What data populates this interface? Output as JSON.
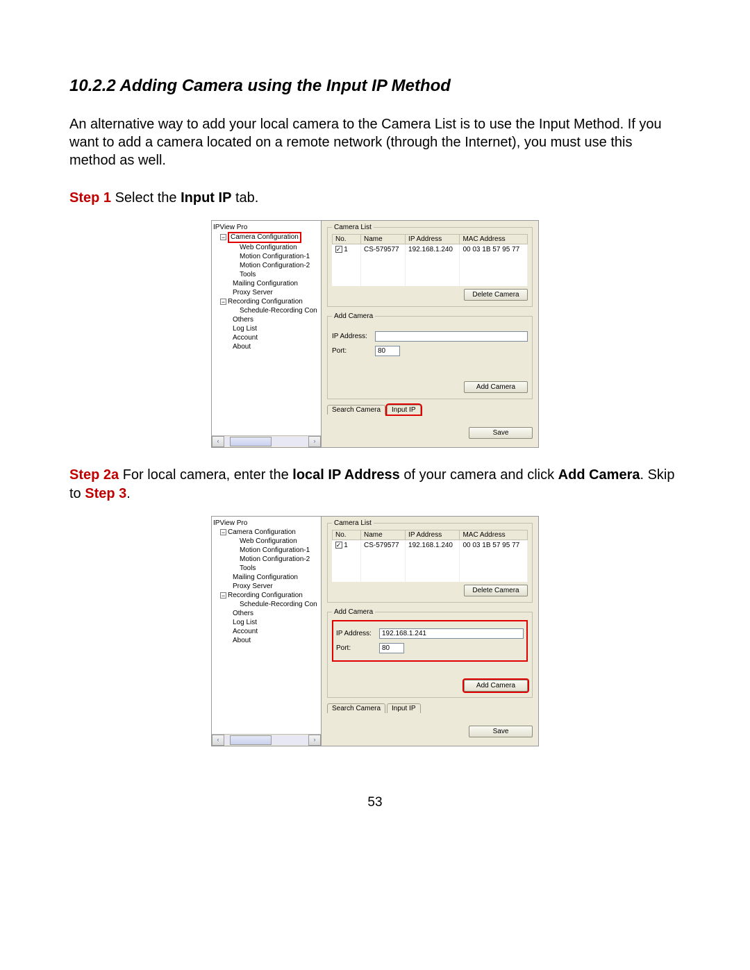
{
  "heading": "10.2.2 Adding Camera using the Input IP Method",
  "intro": "An alternative way to add your local camera to the Camera List is to use the Input Method. If you want to add a camera located on a remote network (through the Internet), you must use this method as well.",
  "step1": {
    "label": "Step 1",
    "text_a": " Select the ",
    "bold": "Input IP",
    "text_b": " tab."
  },
  "step2a": {
    "label": "Step 2a",
    "text_a": " For local camera, enter the ",
    "bold1": "local IP Address",
    "text_b": " of your camera and click ",
    "bold2": "Add Camera",
    "text_c": ". Skip to ",
    "red2": "Step 3",
    "text_d": "."
  },
  "tree": {
    "root": "IPView Pro",
    "items": [
      {
        "label": "Camera Configuration",
        "children": [
          {
            "label": "Web Configuration"
          },
          {
            "label": "Motion Configuration-1"
          },
          {
            "label": "Motion Configuration-2"
          },
          {
            "label": "Tools"
          }
        ]
      },
      {
        "label": "Mailing Configuration"
      },
      {
        "label": "Proxy Server"
      },
      {
        "label": "Recording Configuration",
        "children": [
          {
            "label": "Schedule-Recording Con"
          }
        ]
      },
      {
        "label": "Others"
      },
      {
        "label": "Log List"
      },
      {
        "label": "Account"
      },
      {
        "label": "About"
      }
    ]
  },
  "camera_list": {
    "legend": "Camera List",
    "headers": [
      "No.",
      "Name",
      "IP Address",
      "MAC Address"
    ],
    "rows": [
      {
        "checked": true,
        "no": "1",
        "name": "CS-579577",
        "ip": "192.168.1.240",
        "mac": "00 03 1B 57 95 77"
      }
    ],
    "delete_btn": "Delete Camera"
  },
  "add_camera": {
    "legend": "Add Camera",
    "ip_label": "IP Address:",
    "port_label": "Port:",
    "add_btn": "Add Camera"
  },
  "tabs": {
    "search": "Search Camera",
    "input": "Input IP"
  },
  "save_btn": "Save",
  "shot1": {
    "ip_value": "",
    "port_value": "80",
    "highlight_camera_config": true,
    "highlight_input_tab": true,
    "highlight_ip_row": false,
    "highlight_add_btn": false
  },
  "shot2": {
    "ip_value": "192.168.1.241",
    "port_value": "80",
    "highlight_camera_config": false,
    "highlight_input_tab": false,
    "highlight_ip_row": true,
    "highlight_add_btn": true
  },
  "page_number": "53"
}
